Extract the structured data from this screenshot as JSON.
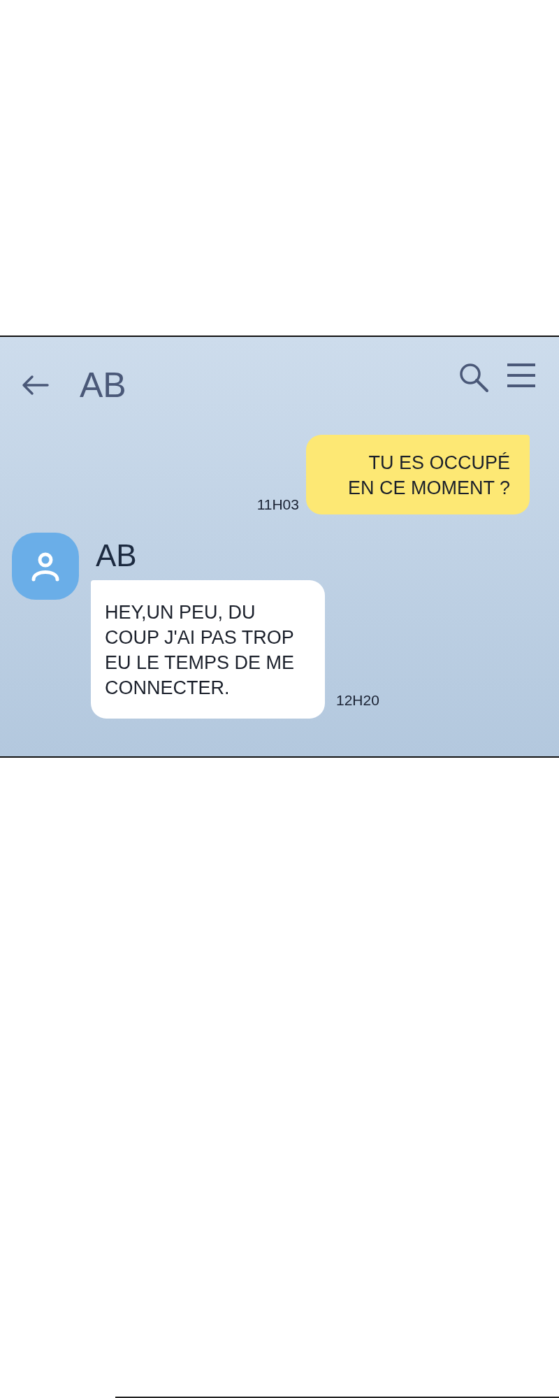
{
  "header": {
    "title": "AB"
  },
  "messages": [
    {
      "kind": "sent",
      "text": "TU ES OCCUPÉ\nEN CE MOMENT ?",
      "time": "11H03"
    },
    {
      "kind": "received",
      "sender": "AB",
      "text": "HEY,UN PEU, DU\nCOUP J'AI PAS TROP\nEU LE TEMPS DE ME\nCONNECTER.",
      "time": "12H20"
    }
  ]
}
